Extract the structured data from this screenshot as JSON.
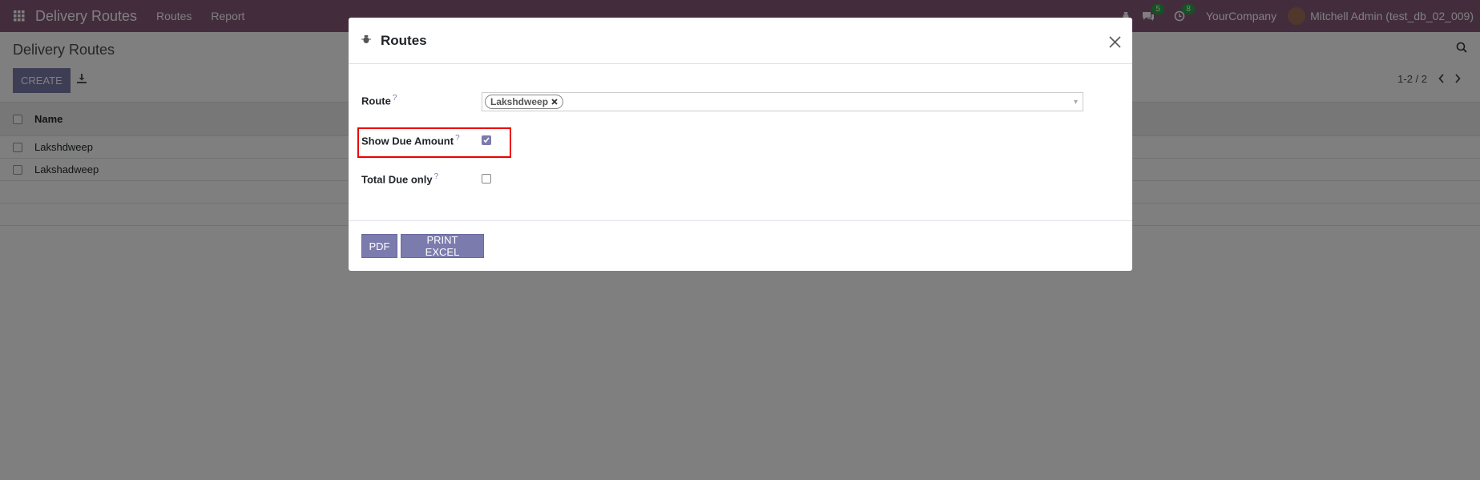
{
  "navbar": {
    "app_title": "Delivery Routes",
    "menu": [
      "Routes",
      "Report"
    ],
    "messages_badge": "5",
    "activities_badge": "8",
    "company": "YourCompany",
    "user": "Mitchell Admin (test_db_02_009)"
  },
  "control": {
    "title": "Delivery Routes",
    "create_label": "CREATE",
    "pager": "1-2 / 2"
  },
  "list": {
    "column_name": "Name",
    "rows": [
      "Lakshdweep",
      "Lakshadweep"
    ]
  },
  "modal": {
    "title": "Routes",
    "route_label": "Route",
    "route_tag": "Lakshdweep",
    "show_due_label": "Show Due Amount",
    "show_due_checked": true,
    "total_due_label": "Total Due only",
    "total_due_checked": false,
    "pdf_label": "PDF",
    "excel_label": "PRINT EXCEL",
    "help_mark": "?"
  },
  "colors": {
    "brand": "#875a7b",
    "button": "#7c7bad",
    "highlight": "#ee0000"
  }
}
